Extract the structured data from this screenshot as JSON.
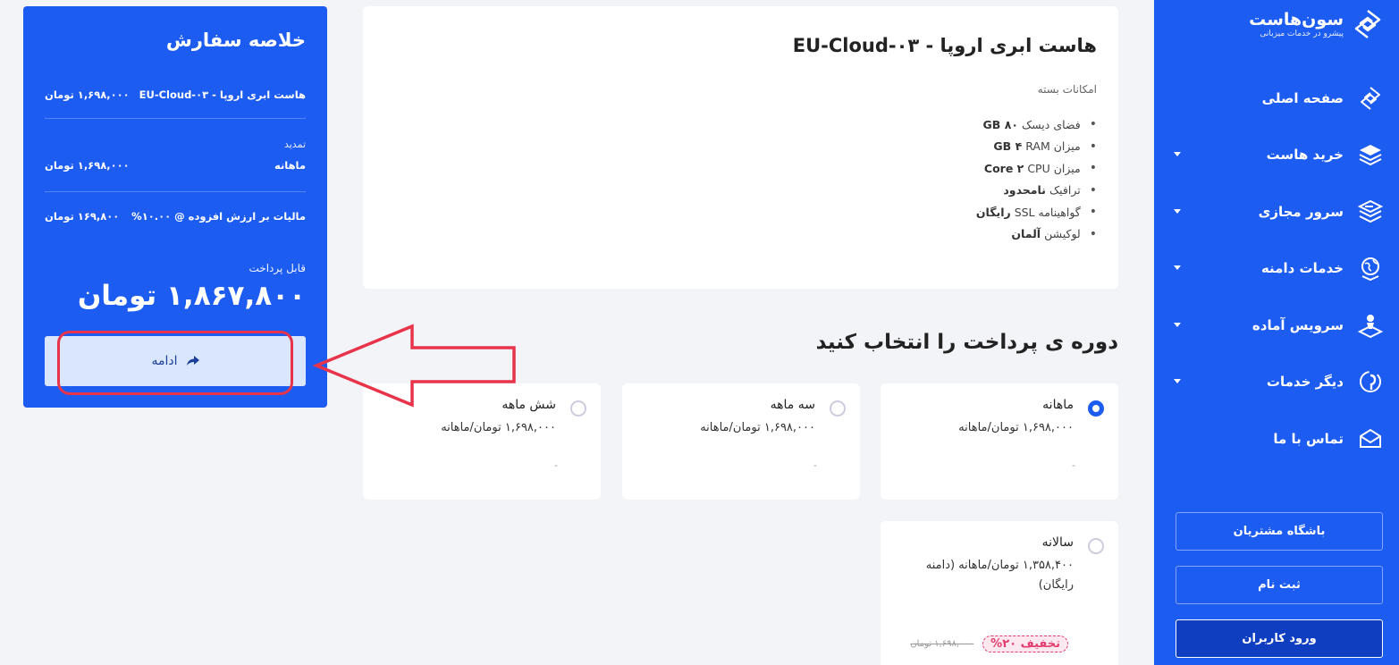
{
  "colors": {
    "brand": "#1c5cf0",
    "discount": "#e33b6e",
    "annotation": "#e8344a"
  },
  "brand": {
    "name": "سون‌هاست",
    "tagline": "پیشرو در خدمات میزبانی"
  },
  "nav": [
    {
      "label": "صفحه اصلی",
      "icon": "home-diamond-icon",
      "caret": false
    },
    {
      "label": "خرید هاست",
      "icon": "host-layers-icon",
      "caret": true
    },
    {
      "label": "سرور مجازی",
      "icon": "vps-server-icon",
      "caret": true
    },
    {
      "label": "خدمات دامنه",
      "icon": "domain-globe-icon",
      "caret": true
    },
    {
      "label": "سرویس آماده",
      "icon": "ready-service-icon",
      "caret": true
    },
    {
      "label": "دیگر خدمات",
      "icon": "other-services-icon",
      "caret": true
    },
    {
      "label": "تماس با ما",
      "icon": "contact-envelope-icon",
      "caret": false
    }
  ],
  "account": {
    "club": "باشگاه مشتریان",
    "register": "ثبت نام",
    "login": "ورود کاربران"
  },
  "product": {
    "title": "هاست ابری اروپا - EU-Cloud-۰۳",
    "features_label": "امکانات بسته",
    "features": [
      {
        "label": "فضای دیسک",
        "value": "۸۰ GB"
      },
      {
        "label": "میزان RAM",
        "value": "۴ GB"
      },
      {
        "label": "میزان CPU",
        "value": "۲ Core"
      },
      {
        "label": "ترافیک",
        "value": "نامحدود"
      },
      {
        "label": "گواهینامه SSL",
        "value": "رایگان"
      },
      {
        "label": "لوکیشن",
        "value": "آلمان"
      }
    ]
  },
  "billing": {
    "title": "دوره ی پرداخت را انتخاب کنید",
    "options": [
      {
        "name": "ماهانه",
        "price": "۱,۶۹۸,۰۰۰ تومان/ماهانه",
        "note": "-",
        "selected": true
      },
      {
        "name": "سه ماهه",
        "price": "۱,۶۹۸,۰۰۰ تومان/ماهانه",
        "note": "-",
        "selected": false
      },
      {
        "name": "شش ماهه",
        "price": "۱,۶۹۸,۰۰۰ تومان/ماهانه",
        "note": "-",
        "selected": false
      },
      {
        "name": "سالانه",
        "price": "۱,۳۵۸,۴۰۰ تومان/ماهانه (دامنه رایگان)",
        "discount": "تخفیف ۲۰%",
        "old_price": "۱,۶۹۸,۰۰۰ تومان",
        "selected": false
      }
    ]
  },
  "summary": {
    "title": "خلاصه سفارش",
    "product_label": "هاست ابری اروپا - EU-Cloud-۰۳",
    "product_price": "۱,۶۹۸,۰۰۰ تومان",
    "renew_label": "تمدید",
    "renew_cycle": "ماهانه",
    "renew_price": "۱,۶۹۸,۰۰۰ تومان",
    "tax_label": "مالیات بر ارزش افزوده @ ۱۰.۰۰%",
    "tax_price": "۱۶۹,۸۰۰ تومان",
    "payable_label": "قابل پرداخت",
    "total": "۱,۸۶۷,۸۰۰ تومان",
    "continue_label": "ادامه"
  }
}
